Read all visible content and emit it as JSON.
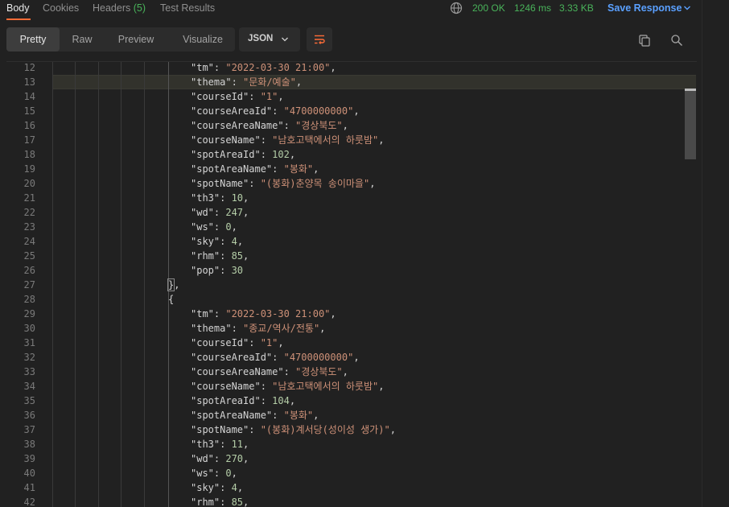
{
  "tabs": [
    {
      "label": "Body"
    },
    {
      "label": "Cookies"
    },
    {
      "label": "Headers",
      "count": "(5)"
    },
    {
      "label": "Test Results"
    }
  ],
  "status": {
    "code": "200 OK",
    "time": "1246 ms",
    "size": "3.33 KB"
  },
  "save_response": "Save Response",
  "view_tabs": [
    "Pretty",
    "Raw",
    "Preview",
    "Visualize"
  ],
  "format": "JSON",
  "colors": {
    "accent": "#ff6c37",
    "ok": "#49b35a",
    "link": "#5aa0ff",
    "string": "#ce9178",
    "number": "#b5cea8"
  },
  "icons": [
    "globe-icon",
    "chevron-down-icon",
    "wrap-lines-icon",
    "copy-icon",
    "search-icon"
  ],
  "lines": [
    {
      "n": "12",
      "key": "tm",
      "type": "str",
      "val": "2022-03-30 21:00",
      "comma": true
    },
    {
      "n": "13",
      "key": "thema",
      "type": "str",
      "val": "문화/예술",
      "comma": true
    },
    {
      "n": "14",
      "key": "courseId",
      "type": "str",
      "val": "1",
      "comma": true
    },
    {
      "n": "15",
      "key": "courseAreaId",
      "type": "str",
      "val": "4700000000",
      "comma": true
    },
    {
      "n": "16",
      "key": "courseAreaName",
      "type": "str",
      "val": "경상북도",
      "comma": true
    },
    {
      "n": "17",
      "key": "courseName",
      "type": "str",
      "val": "남호고택에서의 하룻밤",
      "comma": true
    },
    {
      "n": "18",
      "key": "spotAreaId",
      "type": "num",
      "val": "102",
      "comma": true
    },
    {
      "n": "19",
      "key": "spotAreaName",
      "type": "str",
      "val": "봉화",
      "comma": true
    },
    {
      "n": "20",
      "key": "spotName",
      "type": "str",
      "val": "(봉화)춘양목 송이마을",
      "comma": true
    },
    {
      "n": "21",
      "key": "th3",
      "type": "num",
      "val": "10",
      "comma": true
    },
    {
      "n": "22",
      "key": "wd",
      "type": "num",
      "val": "247",
      "comma": true
    },
    {
      "n": "23",
      "key": "ws",
      "type": "num",
      "val": "0",
      "comma": true
    },
    {
      "n": "24",
      "key": "sky",
      "type": "num",
      "val": "4",
      "comma": true
    },
    {
      "n": "25",
      "key": "rhm",
      "type": "num",
      "val": "85",
      "comma": true
    },
    {
      "n": "26",
      "key": "pop",
      "type": "num",
      "val": "30",
      "comma": false
    },
    {
      "n": "27",
      "brace": "},"
    },
    {
      "n": "28",
      "brace": "{"
    },
    {
      "n": "29",
      "key": "tm",
      "type": "str",
      "val": "2022-03-30 21:00",
      "comma": true
    },
    {
      "n": "30",
      "key": "thema",
      "type": "str",
      "val": "종교/역사/전통",
      "comma": true
    },
    {
      "n": "31",
      "key": "courseId",
      "type": "str",
      "val": "1",
      "comma": true
    },
    {
      "n": "32",
      "key": "courseAreaId",
      "type": "str",
      "val": "4700000000",
      "comma": true
    },
    {
      "n": "33",
      "key": "courseAreaName",
      "type": "str",
      "val": "경상북도",
      "comma": true
    },
    {
      "n": "34",
      "key": "courseName",
      "type": "str",
      "val": "남호고택에서의 하룻밤",
      "comma": true
    },
    {
      "n": "35",
      "key": "spotAreaId",
      "type": "num",
      "val": "104",
      "comma": true
    },
    {
      "n": "36",
      "key": "spotAreaName",
      "type": "str",
      "val": "봉화",
      "comma": true
    },
    {
      "n": "37",
      "key": "spotName",
      "type": "str",
      "val": "(봉화)계서당(성이성 생가)",
      "comma": true
    },
    {
      "n": "38",
      "key": "th3",
      "type": "num",
      "val": "11",
      "comma": true
    },
    {
      "n": "39",
      "key": "wd",
      "type": "num",
      "val": "270",
      "comma": true
    },
    {
      "n": "40",
      "key": "ws",
      "type": "num",
      "val": "0",
      "comma": true
    },
    {
      "n": "41",
      "key": "sky",
      "type": "num",
      "val": "4",
      "comma": true
    },
    {
      "n": "42",
      "key": "rhm",
      "type": "num",
      "val": "85",
      "comma": true
    }
  ]
}
